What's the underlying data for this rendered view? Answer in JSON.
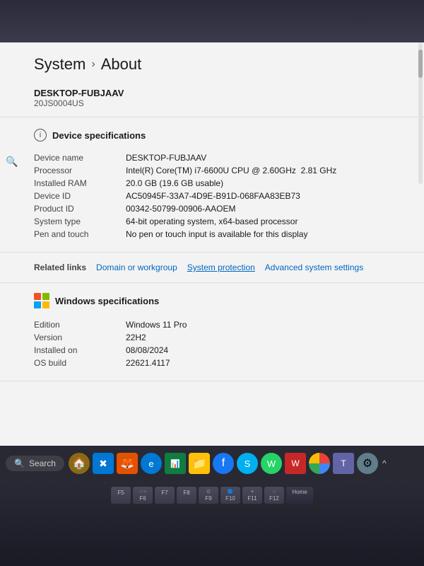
{
  "breadcrumb": {
    "system_label": "System",
    "chevron": "›",
    "about_label": "About"
  },
  "computer": {
    "name": "DESKTOP-FUBJAAV",
    "model": "20JS0004US"
  },
  "device_specs": {
    "section_title": "Device specifications",
    "rows": [
      {
        "label": "Device name",
        "value": "DESKTOP-FUBJAAV"
      },
      {
        "label": "Processor",
        "value": "Intel(R) Core(TM) i7-6600U CPU @ 2.60GHz   2.81 GHz"
      },
      {
        "label": "Installed RAM",
        "value": "20.0 GB (19.6 GB usable)"
      },
      {
        "label": "Device ID",
        "value": "AC50945F-33A7-4D9E-B91D-068FAA83EB73"
      },
      {
        "label": "Product ID",
        "value": "00342-50799-00906-AAOEM"
      },
      {
        "label": "System type",
        "value": "64-bit operating system, x64-based processor"
      },
      {
        "label": "Pen and touch",
        "value": "No pen or touch input is available for this display"
      }
    ]
  },
  "related_links": {
    "label": "Related links",
    "links": [
      {
        "text": "Domain or workgroup"
      },
      {
        "text": "System protection"
      },
      {
        "text": "Advanced system settings"
      }
    ]
  },
  "windows_specs": {
    "section_title": "Windows specifications",
    "rows": [
      {
        "label": "Edition",
        "value": "Windows 11 Pro"
      },
      {
        "label": "Version",
        "value": "22H2"
      },
      {
        "label": "Installed on",
        "value": "08/08/2024"
      },
      {
        "label": "OS build",
        "value": "22621.4117"
      }
    ]
  },
  "taskbar": {
    "search_placeholder": "Search",
    "arrow_label": "^"
  },
  "keyboard": {
    "rows": [
      [
        {
          "top": "",
          "bottom": "F5"
        },
        {
          "top": "☆+",
          "bottom": "F6"
        },
        {
          "top": "",
          "bottom": "F7"
        },
        {
          "top": "",
          "bottom": "F8"
        },
        {
          "top": "⚙",
          "bottom": "F9"
        },
        {
          "top": "🔵",
          "bottom": "F10"
        },
        {
          "top": "✦",
          "bottom": "F11"
        },
        {
          "top": "☆",
          "bottom": "F12"
        },
        {
          "top": "",
          "bottom": "Home"
        }
      ]
    ]
  }
}
